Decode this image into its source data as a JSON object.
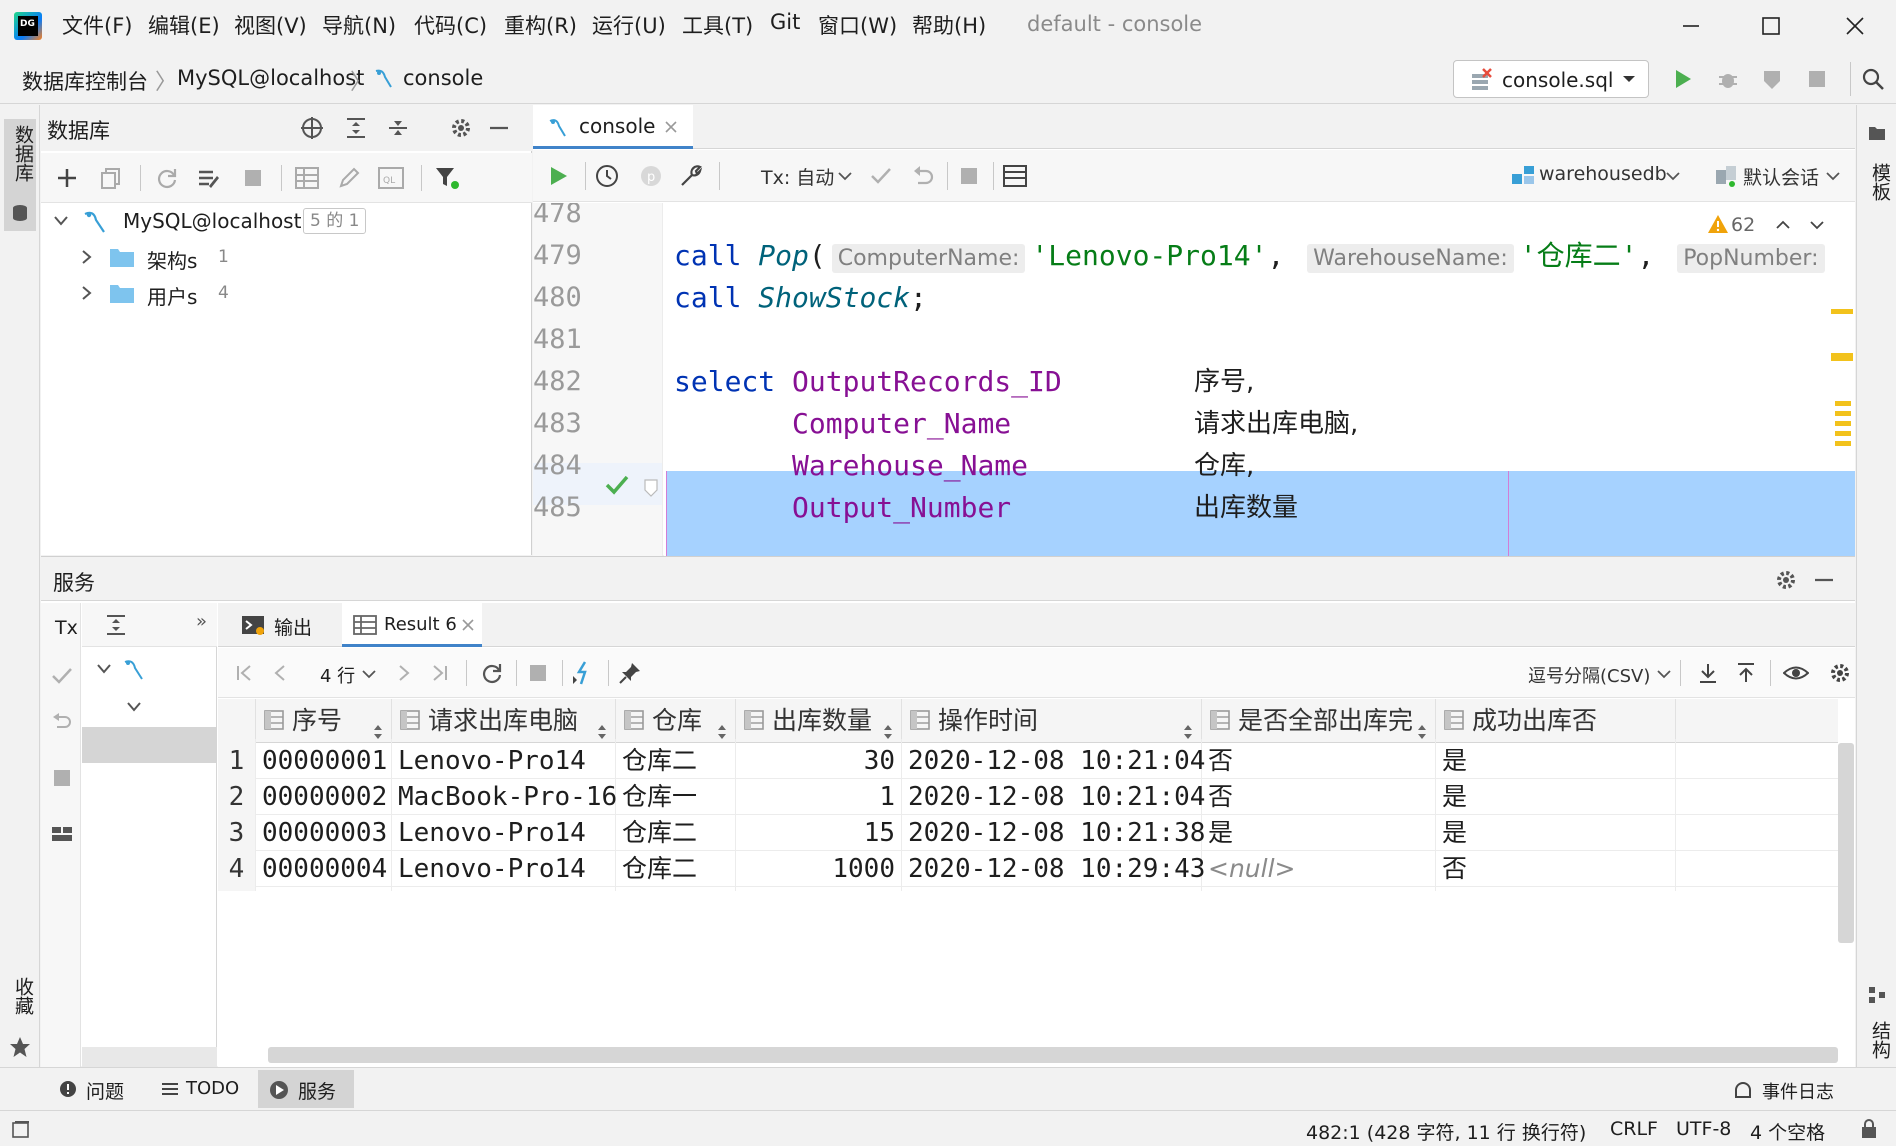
{
  "window": {
    "title": "default - console",
    "menu": [
      "文件(F)",
      "编辑(E)",
      "视图(V)",
      "导航(N)",
      "代码(C)",
      "重构(R)",
      "运行(U)",
      "工具(T)",
      "Git",
      "窗口(W)",
      "帮助(H)"
    ]
  },
  "breadcrumb": [
    "数据库控制台",
    "MySQL@localhost",
    "console"
  ],
  "run_config": {
    "label": "console.sql"
  },
  "db_panel": {
    "title": "数据库",
    "root": {
      "name": "MySQL@localhost",
      "badge": "5 的 1"
    },
    "children": [
      {
        "name": "架构s",
        "count": "1"
      },
      {
        "name": "用户s",
        "count": "4"
      }
    ]
  },
  "left_strip": {
    "top": "数据库",
    "bottom": "收藏"
  },
  "right_strip": {
    "top": "模板",
    "bottom": "结构"
  },
  "editor": {
    "tab": "console",
    "tx_label": "Tx: 自动",
    "schema": "warehousedb",
    "session": "默认会话",
    "warnings": "62",
    "lines": [
      {
        "num": "478"
      },
      {
        "num": "479",
        "kw": "call",
        "fn": "Pop",
        "params": [
          {
            "hint": "ComputerName:",
            "val": "'Lenovo-Pro14'"
          },
          {
            "hint": "WarehouseName:",
            "val": "'仓库二'"
          },
          {
            "hint": "PopNumber:",
            "val": ""
          }
        ]
      },
      {
        "num": "480",
        "kw": "call",
        "fn": "ShowStock",
        "tail": ";"
      },
      {
        "num": "481"
      },
      {
        "num": "482",
        "kw": "select",
        "col": "OutputRecords_ID",
        "alias": "序号,"
      },
      {
        "num": "483",
        "col": "Computer_Name",
        "alias": "请求出库电脑,"
      },
      {
        "num": "484",
        "col": "Warehouse_Name",
        "alias": "仓库,"
      },
      {
        "num": "485",
        "col": "Output_Number",
        "alias": "出库数量"
      }
    ]
  },
  "services": {
    "title": "服务",
    "tx": "Tx",
    "tabs": [
      {
        "label": "输出"
      },
      {
        "label": "Result 6"
      }
    ],
    "rows_label": "4 行",
    "export_label": "逗号分隔(CSV)",
    "columns": [
      "序号",
      "请求出库电脑",
      "仓库",
      "出库数量",
      "操作时间",
      "是否全部出库完",
      "成功出库否"
    ],
    "rows": [
      {
        "n": "1",
        "cells": [
          "00000001",
          "Lenovo-Pro14",
          "仓库二",
          "30",
          "2020-12-08 10:21:04",
          "否",
          "是"
        ]
      },
      {
        "n": "2",
        "cells": [
          "00000002",
          "MacBook-Pro-16",
          "仓库一",
          "1",
          "2020-12-08 10:21:04",
          "否",
          "是"
        ]
      },
      {
        "n": "3",
        "cells": [
          "00000003",
          "Lenovo-Pro14",
          "仓库二",
          "15",
          "2020-12-08 10:21:38",
          "是",
          "是"
        ]
      },
      {
        "n": "4",
        "cells": [
          "00000004",
          "Lenovo-Pro14",
          "仓库二",
          "1000",
          "2020-12-08 10:29:43",
          "<null>",
          "否"
        ]
      }
    ]
  },
  "bottom_tabs": [
    "问题",
    "TODO",
    "服务"
  ],
  "event_log": "事件日志",
  "status": {
    "position": "482:1 (428 字符, 11 行 换行符)",
    "line_sep": "CRLF",
    "encoding": "UTF-8",
    "indent": "4 个空格"
  },
  "colors": {
    "selection": "#a6d2ff",
    "keyword": "#0033b3",
    "identifier": "#871094",
    "string": "#067d17",
    "accent": "#389fd6"
  }
}
